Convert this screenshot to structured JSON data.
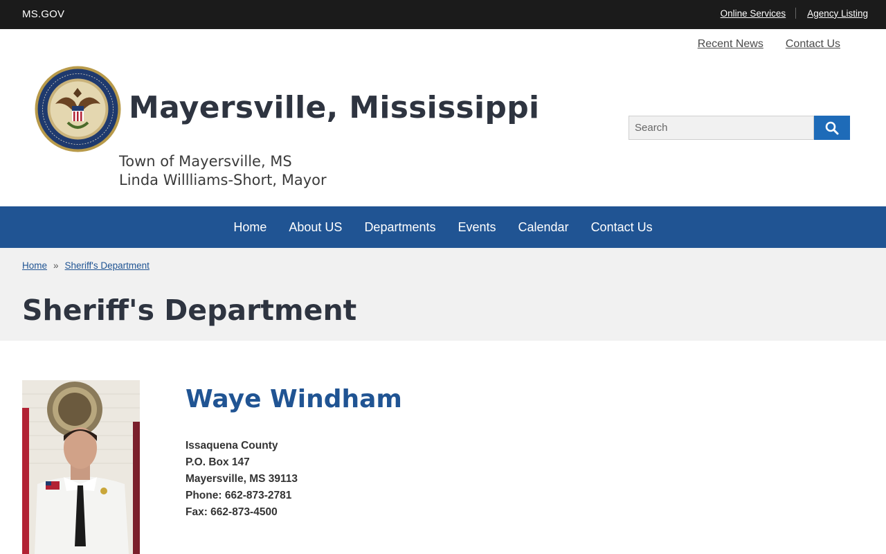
{
  "topbar": {
    "brand": "MS.GOV",
    "links": [
      "Online Services",
      "Agency Listing"
    ]
  },
  "secondary_links": [
    "Recent News",
    "Contact Us"
  ],
  "header": {
    "title": "Mayersville, Mississippi",
    "subtitle_line1": "Town of Mayersville, MS",
    "subtitle_line2": "Linda Willliams-Short, Mayor",
    "seal_icon": "state-seal-icon"
  },
  "search": {
    "placeholder": "Search",
    "button_icon": "search-icon"
  },
  "nav": {
    "items": [
      "Home",
      "About US",
      "Departments",
      "Events",
      "Calendar",
      "Contact Us"
    ]
  },
  "breadcrumb": {
    "items": [
      "Home",
      "Sheriff's Department"
    ],
    "separator": "»"
  },
  "page": {
    "title": "Sheriff's Department"
  },
  "profile": {
    "name": "Waye Windham",
    "lines": [
      "Issaquena County",
      "P.O. Box 147",
      "Mayersville, MS 39113",
      "Phone: 662-873-2781",
      "Fax: 662-873-4500"
    ]
  },
  "colors": {
    "topbar": "#1b1b1b",
    "nav": "#205493",
    "accent": "#1e6bb8",
    "band": "#f1f1f1",
    "title": "#2e3440"
  }
}
